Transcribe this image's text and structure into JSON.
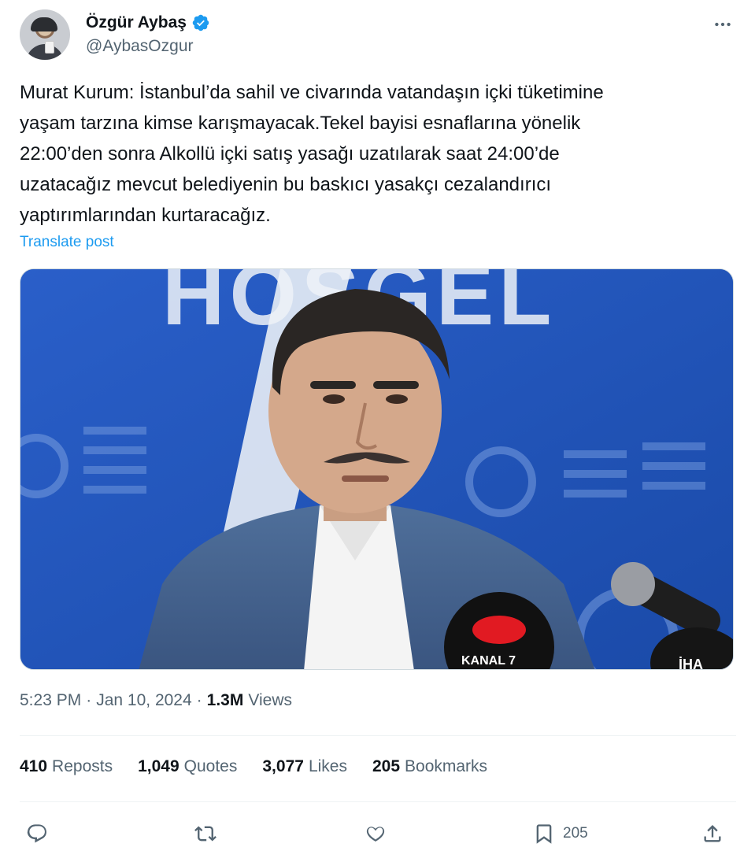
{
  "author": {
    "display_name": "Özgür Aybaş",
    "handle": "@AybasOzgur",
    "verified": true
  },
  "tweet": {
    "text": "Murat Kurum:  İstanbul’da sahil ve civarında vatandaşın içki tüketimine\nyaşam tarzına kimse karışmayacak.Tekel bayisi esnaflarına yönelik\n22:00’den sonra Alkollü içki satış yasağı uzatılarak saat 24:00’de\nuzatacağız mevcut belediyenin bu baskıcı yasakçı cezalandırıcı\nyaptırımlarından kurtaracağız.",
    "translate_label": "Translate post"
  },
  "media": {
    "background_text": "HOŞGEL",
    "mic_logo_text": "KANAL 7",
    "mic_right_text": "İHA"
  },
  "meta": {
    "time": "5:23 PM",
    "separator": "·",
    "date": "Jan 10, 2024",
    "views_count": "1.3M",
    "views_label": "Views"
  },
  "stats": {
    "reposts": {
      "num": "410",
      "label": "Reposts"
    },
    "quotes": {
      "num": "1,049",
      "label": "Quotes"
    },
    "likes": {
      "num": "3,077",
      "label": "Likes"
    },
    "bookmarks": {
      "num": "205",
      "label": "Bookmarks"
    }
  },
  "actions": {
    "bookmark_count": "205"
  },
  "colors": {
    "accent": "#1d9bf0",
    "text_primary": "#0f1419",
    "text_secondary": "#536471",
    "divider": "#eff3f4"
  },
  "icons": [
    "verified-badge-icon",
    "more-icon",
    "reply-icon",
    "repost-icon",
    "like-icon",
    "bookmark-icon",
    "share-icon"
  ]
}
